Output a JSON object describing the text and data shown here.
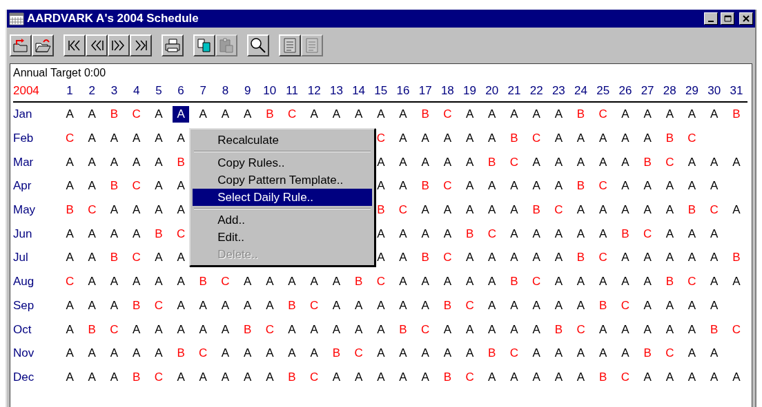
{
  "window": {
    "title": "AARDVARK A's 2004 Schedule"
  },
  "toolbar_groups": [
    [
      {
        "kind": "undo",
        "disabled": false
      },
      {
        "kind": "open",
        "disabled": false
      }
    ],
    [
      {
        "kind": "first",
        "disabled": false
      },
      {
        "kind": "prev",
        "disabled": false
      },
      {
        "kind": "next",
        "disabled": false
      },
      {
        "kind": "last",
        "disabled": false
      }
    ],
    [
      {
        "kind": "print",
        "disabled": false
      }
    ],
    [
      {
        "kind": "copy",
        "disabled": false
      },
      {
        "kind": "paste",
        "disabled": true
      }
    ],
    [
      {
        "kind": "find",
        "disabled": false
      }
    ],
    [
      {
        "kind": "page",
        "disabled": false
      },
      {
        "kind": "page",
        "disabled": true
      }
    ]
  ],
  "annual_target": "Annual Target 0:00",
  "year": "2004",
  "days": [
    "1",
    "2",
    "3",
    "4",
    "5",
    "6",
    "7",
    "8",
    "9",
    "10",
    "11",
    "12",
    "13",
    "14",
    "15",
    "16",
    "17",
    "18",
    "19",
    "20",
    "21",
    "22",
    "23",
    "24",
    "25",
    "26",
    "27",
    "28",
    "29",
    "30",
    "31"
  ],
  "months": [
    {
      "name": "Jan",
      "cells": [
        {
          "text": "A",
          "color": "#000000",
          "selected": false
        },
        {
          "text": "A",
          "color": "#000000",
          "selected": false
        },
        {
          "text": "B",
          "color": "#ff0000",
          "selected": false
        },
        {
          "text": "C",
          "color": "#ff0000",
          "selected": false
        },
        {
          "text": "A",
          "color": "#000000",
          "selected": false
        },
        {
          "text": "A",
          "selected": true
        },
        {
          "text": "A",
          "color": "#000000",
          "selected": false
        },
        {
          "text": "A",
          "color": "#000000",
          "selected": false
        },
        {
          "text": "A",
          "color": "#000000",
          "selected": false
        },
        {
          "text": "B",
          "color": "#ff0000",
          "selected": false
        },
        {
          "text": "C",
          "color": "#ff0000",
          "selected": false
        },
        {
          "text": "A",
          "color": "#000000",
          "selected": false
        },
        {
          "text": "A",
          "color": "#000000",
          "selected": false
        },
        {
          "text": "A",
          "color": "#000000",
          "selected": false
        },
        {
          "text": "A",
          "color": "#000000",
          "selected": false
        },
        {
          "text": "A",
          "color": "#000000",
          "selected": false
        },
        {
          "text": "B",
          "color": "#ff0000",
          "selected": false
        },
        {
          "text": "C",
          "color": "#ff0000",
          "selected": false
        },
        {
          "text": "A",
          "color": "#000000",
          "selected": false
        },
        {
          "text": "A",
          "color": "#000000",
          "selected": false
        },
        {
          "text": "A",
          "color": "#000000",
          "selected": false
        },
        {
          "text": "A",
          "color": "#000000",
          "selected": false
        },
        {
          "text": "A",
          "color": "#000000",
          "selected": false
        },
        {
          "text": "B",
          "color": "#ff0000",
          "selected": false
        },
        {
          "text": "C",
          "color": "#ff0000",
          "selected": false
        },
        {
          "text": "A",
          "color": "#000000",
          "selected": false
        },
        {
          "text": "A",
          "color": "#000000",
          "selected": false
        },
        {
          "text": "A",
          "color": "#000000",
          "selected": false
        },
        {
          "text": "A",
          "color": "#000000",
          "selected": false
        },
        {
          "text": "A",
          "color": "#000000",
          "selected": false
        },
        {
          "text": "B",
          "color": "#ff0000",
          "selected": false
        }
      ]
    },
    {
      "name": "Feb",
      "cells": [
        {
          "text": "C",
          "color": "#ff0000",
          "selected": false
        },
        {
          "text": "A",
          "color": "#000000",
          "selected": false
        },
        {
          "text": "A",
          "color": "#000000",
          "selected": false
        },
        {
          "text": "A",
          "color": "#000000",
          "selected": false
        },
        {
          "text": "A",
          "color": "#000000",
          "selected": false
        },
        {
          "text": "A",
          "color": "#000000",
          "selected": false
        },
        null,
        null,
        null,
        null,
        null,
        null,
        null,
        null,
        {
          "text": "C",
          "color": "#ff0000",
          "selected": false
        },
        {
          "text": "A",
          "color": "#000000",
          "selected": false
        },
        {
          "text": "A",
          "color": "#000000",
          "selected": false
        },
        {
          "text": "A",
          "color": "#000000",
          "selected": false
        },
        {
          "text": "A",
          "color": "#000000",
          "selected": false
        },
        {
          "text": "A",
          "color": "#000000",
          "selected": false
        },
        {
          "text": "B",
          "color": "#ff0000",
          "selected": false
        },
        {
          "text": "C",
          "color": "#ff0000",
          "selected": false
        },
        {
          "text": "A",
          "color": "#000000",
          "selected": false
        },
        {
          "text": "A",
          "color": "#000000",
          "selected": false
        },
        {
          "text": "A",
          "color": "#000000",
          "selected": false
        },
        {
          "text": "A",
          "color": "#000000",
          "selected": false
        },
        {
          "text": "A",
          "color": "#000000",
          "selected": false
        },
        {
          "text": "B",
          "color": "#ff0000",
          "selected": false
        },
        {
          "text": "C",
          "color": "#ff0000",
          "selected": false
        },
        null,
        null
      ]
    },
    {
      "name": "Mar",
      "cells": [
        {
          "text": "A",
          "color": "#000000",
          "selected": false
        },
        {
          "text": "A",
          "color": "#000000",
          "selected": false
        },
        {
          "text": "A",
          "color": "#000000",
          "selected": false
        },
        {
          "text": "A",
          "color": "#000000",
          "selected": false
        },
        {
          "text": "A",
          "color": "#000000",
          "selected": false
        },
        {
          "text": "B",
          "color": "#ff0000",
          "selected": false
        },
        null,
        null,
        null,
        null,
        null,
        null,
        null,
        null,
        {
          "text": "A",
          "color": "#000000",
          "selected": false
        },
        {
          "text": "A",
          "color": "#000000",
          "selected": false
        },
        {
          "text": "A",
          "color": "#000000",
          "selected": false
        },
        {
          "text": "A",
          "color": "#000000",
          "selected": false
        },
        {
          "text": "A",
          "color": "#000000",
          "selected": false
        },
        {
          "text": "B",
          "color": "#ff0000",
          "selected": false
        },
        {
          "text": "C",
          "color": "#ff0000",
          "selected": false
        },
        {
          "text": "A",
          "color": "#000000",
          "selected": false
        },
        {
          "text": "A",
          "color": "#000000",
          "selected": false
        },
        {
          "text": "A",
          "color": "#000000",
          "selected": false
        },
        {
          "text": "A",
          "color": "#000000",
          "selected": false
        },
        {
          "text": "A",
          "color": "#000000",
          "selected": false
        },
        {
          "text": "B",
          "color": "#ff0000",
          "selected": false
        },
        {
          "text": "C",
          "color": "#ff0000",
          "selected": false
        },
        {
          "text": "A",
          "color": "#000000",
          "selected": false
        },
        {
          "text": "A",
          "color": "#000000",
          "selected": false
        },
        {
          "text": "A",
          "color": "#000000",
          "selected": false
        }
      ]
    },
    {
      "name": "Apr",
      "cells": [
        {
          "text": "A",
          "color": "#000000",
          "selected": false
        },
        {
          "text": "A",
          "color": "#000000",
          "selected": false
        },
        {
          "text": "B",
          "color": "#ff0000",
          "selected": false
        },
        {
          "text": "C",
          "color": "#ff0000",
          "selected": false
        },
        {
          "text": "A",
          "color": "#000000",
          "selected": false
        },
        {
          "text": "A",
          "color": "#000000",
          "selected": false
        },
        null,
        null,
        null,
        null,
        null,
        null,
        null,
        null,
        {
          "text": "A",
          "color": "#000000",
          "selected": false
        },
        {
          "text": "A",
          "color": "#000000",
          "selected": false
        },
        {
          "text": "B",
          "color": "#ff0000",
          "selected": false
        },
        {
          "text": "C",
          "color": "#ff0000",
          "selected": false
        },
        {
          "text": "A",
          "color": "#000000",
          "selected": false
        },
        {
          "text": "A",
          "color": "#000000",
          "selected": false
        },
        {
          "text": "A",
          "color": "#000000",
          "selected": false
        },
        {
          "text": "A",
          "color": "#000000",
          "selected": false
        },
        {
          "text": "A",
          "color": "#000000",
          "selected": false
        },
        {
          "text": "B",
          "color": "#ff0000",
          "selected": false
        },
        {
          "text": "C",
          "color": "#ff0000",
          "selected": false
        },
        {
          "text": "A",
          "color": "#000000",
          "selected": false
        },
        {
          "text": "A",
          "color": "#000000",
          "selected": false
        },
        {
          "text": "A",
          "color": "#000000",
          "selected": false
        },
        {
          "text": "A",
          "color": "#000000",
          "selected": false
        },
        {
          "text": "A",
          "color": "#000000",
          "selected": false
        },
        null
      ]
    },
    {
      "name": "May",
      "cells": [
        {
          "text": "B",
          "color": "#ff0000",
          "selected": false
        },
        {
          "text": "C",
          "color": "#ff0000",
          "selected": false
        },
        {
          "text": "A",
          "color": "#000000",
          "selected": false
        },
        {
          "text": "A",
          "color": "#000000",
          "selected": false
        },
        {
          "text": "A",
          "color": "#000000",
          "selected": false
        },
        {
          "text": "A",
          "color": "#000000",
          "selected": false
        },
        null,
        null,
        null,
        null,
        null,
        null,
        null,
        null,
        {
          "text": "B",
          "color": "#ff0000",
          "selected": false
        },
        {
          "text": "C",
          "color": "#ff0000",
          "selected": false
        },
        {
          "text": "A",
          "color": "#000000",
          "selected": false
        },
        {
          "text": "A",
          "color": "#000000",
          "selected": false
        },
        {
          "text": "A",
          "color": "#000000",
          "selected": false
        },
        {
          "text": "A",
          "color": "#000000",
          "selected": false
        },
        {
          "text": "A",
          "color": "#000000",
          "selected": false
        },
        {
          "text": "B",
          "color": "#ff0000",
          "selected": false
        },
        {
          "text": "C",
          "color": "#ff0000",
          "selected": false
        },
        {
          "text": "A",
          "color": "#000000",
          "selected": false
        },
        {
          "text": "A",
          "color": "#000000",
          "selected": false
        },
        {
          "text": "A",
          "color": "#000000",
          "selected": false
        },
        {
          "text": "A",
          "color": "#000000",
          "selected": false
        },
        {
          "text": "A",
          "color": "#000000",
          "selected": false
        },
        {
          "text": "B",
          "color": "#ff0000",
          "selected": false
        },
        {
          "text": "C",
          "color": "#ff0000",
          "selected": false
        },
        {
          "text": "A",
          "color": "#000000",
          "selected": false
        }
      ]
    },
    {
      "name": "Jun",
      "cells": [
        {
          "text": "A",
          "color": "#000000",
          "selected": false
        },
        {
          "text": "A",
          "color": "#000000",
          "selected": false
        },
        {
          "text": "A",
          "color": "#000000",
          "selected": false
        },
        {
          "text": "A",
          "color": "#000000",
          "selected": false
        },
        {
          "text": "B",
          "color": "#ff0000",
          "selected": false
        },
        {
          "text": "C",
          "color": "#ff0000",
          "selected": false
        },
        null,
        null,
        null,
        null,
        null,
        null,
        null,
        null,
        {
          "text": "A",
          "color": "#000000",
          "selected": false
        },
        {
          "text": "A",
          "color": "#000000",
          "selected": false
        },
        {
          "text": "A",
          "color": "#000000",
          "selected": false
        },
        {
          "text": "A",
          "color": "#000000",
          "selected": false
        },
        {
          "text": "B",
          "color": "#ff0000",
          "selected": false
        },
        {
          "text": "C",
          "color": "#ff0000",
          "selected": false
        },
        {
          "text": "A",
          "color": "#000000",
          "selected": false
        },
        {
          "text": "A",
          "color": "#000000",
          "selected": false
        },
        {
          "text": "A",
          "color": "#000000",
          "selected": false
        },
        {
          "text": "A",
          "color": "#000000",
          "selected": false
        },
        {
          "text": "A",
          "color": "#000000",
          "selected": false
        },
        {
          "text": "B",
          "color": "#ff0000",
          "selected": false
        },
        {
          "text": "C",
          "color": "#ff0000",
          "selected": false
        },
        {
          "text": "A",
          "color": "#000000",
          "selected": false
        },
        {
          "text": "A",
          "color": "#000000",
          "selected": false
        },
        {
          "text": "A",
          "color": "#000000",
          "selected": false
        },
        null
      ]
    },
    {
      "name": "Jul",
      "cells": [
        {
          "text": "A",
          "color": "#000000",
          "selected": false
        },
        {
          "text": "A",
          "color": "#000000",
          "selected": false
        },
        {
          "text": "B",
          "color": "#ff0000",
          "selected": false
        },
        {
          "text": "C",
          "color": "#ff0000",
          "selected": false
        },
        {
          "text": "A",
          "color": "#000000",
          "selected": false
        },
        {
          "text": "A",
          "color": "#000000",
          "selected": false
        },
        null,
        null,
        null,
        null,
        null,
        null,
        null,
        null,
        {
          "text": "A",
          "color": "#000000",
          "selected": false
        },
        {
          "text": "A",
          "color": "#000000",
          "selected": false
        },
        {
          "text": "B",
          "color": "#ff0000",
          "selected": false
        },
        {
          "text": "C",
          "color": "#ff0000",
          "selected": false
        },
        {
          "text": "A",
          "color": "#000000",
          "selected": false
        },
        {
          "text": "A",
          "color": "#000000",
          "selected": false
        },
        {
          "text": "A",
          "color": "#000000",
          "selected": false
        },
        {
          "text": "A",
          "color": "#000000",
          "selected": false
        },
        {
          "text": "A",
          "color": "#000000",
          "selected": false
        },
        {
          "text": "B",
          "color": "#ff0000",
          "selected": false
        },
        {
          "text": "C",
          "color": "#ff0000",
          "selected": false
        },
        {
          "text": "A",
          "color": "#000000",
          "selected": false
        },
        {
          "text": "A",
          "color": "#000000",
          "selected": false
        },
        {
          "text": "A",
          "color": "#000000",
          "selected": false
        },
        {
          "text": "A",
          "color": "#000000",
          "selected": false
        },
        {
          "text": "A",
          "color": "#000000",
          "selected": false
        },
        {
          "text": "B",
          "color": "#ff0000",
          "selected": false
        }
      ]
    },
    {
      "name": "Aug",
      "cells": [
        {
          "text": "C",
          "color": "#ff0000",
          "selected": false
        },
        {
          "text": "A",
          "color": "#000000",
          "selected": false
        },
        {
          "text": "A",
          "color": "#000000",
          "selected": false
        },
        {
          "text": "A",
          "color": "#000000",
          "selected": false
        },
        {
          "text": "A",
          "color": "#000000",
          "selected": false
        },
        {
          "text": "A",
          "color": "#000000",
          "selected": false
        },
        {
          "text": "B",
          "color": "#ff0000",
          "selected": false
        },
        {
          "text": "C",
          "color": "#ff0000",
          "selected": false
        },
        {
          "text": "A",
          "color": "#000000",
          "selected": false
        },
        {
          "text": "A",
          "color": "#000000",
          "selected": false
        },
        {
          "text": "A",
          "color": "#000000",
          "selected": false
        },
        {
          "text": "A",
          "color": "#000000",
          "selected": false
        },
        {
          "text": "A",
          "color": "#000000",
          "selected": false
        },
        {
          "text": "B",
          "color": "#ff0000",
          "selected": false
        },
        {
          "text": "C",
          "color": "#ff0000",
          "selected": false
        },
        {
          "text": "A",
          "color": "#000000",
          "selected": false
        },
        {
          "text": "A",
          "color": "#000000",
          "selected": false
        },
        {
          "text": "A",
          "color": "#000000",
          "selected": false
        },
        {
          "text": "A",
          "color": "#000000",
          "selected": false
        },
        {
          "text": "A",
          "color": "#000000",
          "selected": false
        },
        {
          "text": "B",
          "color": "#ff0000",
          "selected": false
        },
        {
          "text": "C",
          "color": "#ff0000",
          "selected": false
        },
        {
          "text": "A",
          "color": "#000000",
          "selected": false
        },
        {
          "text": "A",
          "color": "#000000",
          "selected": false
        },
        {
          "text": "A",
          "color": "#000000",
          "selected": false
        },
        {
          "text": "A",
          "color": "#000000",
          "selected": false
        },
        {
          "text": "A",
          "color": "#000000",
          "selected": false
        },
        {
          "text": "B",
          "color": "#ff0000",
          "selected": false
        },
        {
          "text": "C",
          "color": "#ff0000",
          "selected": false
        },
        {
          "text": "A",
          "color": "#000000",
          "selected": false
        },
        {
          "text": "A",
          "color": "#000000",
          "selected": false
        }
      ]
    },
    {
      "name": "Sep",
      "cells": [
        {
          "text": "A",
          "color": "#000000",
          "selected": false
        },
        {
          "text": "A",
          "color": "#000000",
          "selected": false
        },
        {
          "text": "A",
          "color": "#000000",
          "selected": false
        },
        {
          "text": "B",
          "color": "#ff0000",
          "selected": false
        },
        {
          "text": "C",
          "color": "#ff0000",
          "selected": false
        },
        {
          "text": "A",
          "color": "#000000",
          "selected": false
        },
        {
          "text": "A",
          "color": "#000000",
          "selected": false
        },
        {
          "text": "A",
          "color": "#000000",
          "selected": false
        },
        {
          "text": "A",
          "color": "#000000",
          "selected": false
        },
        {
          "text": "A",
          "color": "#000000",
          "selected": false
        },
        {
          "text": "B",
          "color": "#ff0000",
          "selected": false
        },
        {
          "text": "C",
          "color": "#ff0000",
          "selected": false
        },
        {
          "text": "A",
          "color": "#000000",
          "selected": false
        },
        {
          "text": "A",
          "color": "#000000",
          "selected": false
        },
        {
          "text": "A",
          "color": "#000000",
          "selected": false
        },
        {
          "text": "A",
          "color": "#000000",
          "selected": false
        },
        {
          "text": "A",
          "color": "#000000",
          "selected": false
        },
        {
          "text": "B",
          "color": "#ff0000",
          "selected": false
        },
        {
          "text": "C",
          "color": "#ff0000",
          "selected": false
        },
        {
          "text": "A",
          "color": "#000000",
          "selected": false
        },
        {
          "text": "A",
          "color": "#000000",
          "selected": false
        },
        {
          "text": "A",
          "color": "#000000",
          "selected": false
        },
        {
          "text": "A",
          "color": "#000000",
          "selected": false
        },
        {
          "text": "A",
          "color": "#000000",
          "selected": false
        },
        {
          "text": "B",
          "color": "#ff0000",
          "selected": false
        },
        {
          "text": "C",
          "color": "#ff0000",
          "selected": false
        },
        {
          "text": "A",
          "color": "#000000",
          "selected": false
        },
        {
          "text": "A",
          "color": "#000000",
          "selected": false
        },
        {
          "text": "A",
          "color": "#000000",
          "selected": false
        },
        {
          "text": "A",
          "color": "#000000",
          "selected": false
        },
        null
      ]
    },
    {
      "name": "Oct",
      "cells": [
        {
          "text": "A",
          "color": "#000000",
          "selected": false
        },
        {
          "text": "B",
          "color": "#ff0000",
          "selected": false
        },
        {
          "text": "C",
          "color": "#ff0000",
          "selected": false
        },
        {
          "text": "A",
          "color": "#000000",
          "selected": false
        },
        {
          "text": "A",
          "color": "#000000",
          "selected": false
        },
        {
          "text": "A",
          "color": "#000000",
          "selected": false
        },
        {
          "text": "A",
          "color": "#000000",
          "selected": false
        },
        {
          "text": "A",
          "color": "#000000",
          "selected": false
        },
        {
          "text": "B",
          "color": "#ff0000",
          "selected": false
        },
        {
          "text": "C",
          "color": "#ff0000",
          "selected": false
        },
        {
          "text": "A",
          "color": "#000000",
          "selected": false
        },
        {
          "text": "A",
          "color": "#000000",
          "selected": false
        },
        {
          "text": "A",
          "color": "#000000",
          "selected": false
        },
        {
          "text": "A",
          "color": "#000000",
          "selected": false
        },
        {
          "text": "A",
          "color": "#000000",
          "selected": false
        },
        {
          "text": "B",
          "color": "#ff0000",
          "selected": false
        },
        {
          "text": "C",
          "color": "#ff0000",
          "selected": false
        },
        {
          "text": "A",
          "color": "#000000",
          "selected": false
        },
        {
          "text": "A",
          "color": "#000000",
          "selected": false
        },
        {
          "text": "A",
          "color": "#000000",
          "selected": false
        },
        {
          "text": "A",
          "color": "#000000",
          "selected": false
        },
        {
          "text": "A",
          "color": "#000000",
          "selected": false
        },
        {
          "text": "B",
          "color": "#ff0000",
          "selected": false
        },
        {
          "text": "C",
          "color": "#ff0000",
          "selected": false
        },
        {
          "text": "A",
          "color": "#000000",
          "selected": false
        },
        {
          "text": "A",
          "color": "#000000",
          "selected": false
        },
        {
          "text": "A",
          "color": "#000000",
          "selected": false
        },
        {
          "text": "A",
          "color": "#000000",
          "selected": false
        },
        {
          "text": "A",
          "color": "#000000",
          "selected": false
        },
        {
          "text": "B",
          "color": "#ff0000",
          "selected": false
        },
        {
          "text": "C",
          "color": "#ff0000",
          "selected": false
        }
      ]
    },
    {
      "name": "Nov",
      "cells": [
        {
          "text": "A",
          "color": "#000000",
          "selected": false
        },
        {
          "text": "A",
          "color": "#000000",
          "selected": false
        },
        {
          "text": "A",
          "color": "#000000",
          "selected": false
        },
        {
          "text": "A",
          "color": "#000000",
          "selected": false
        },
        {
          "text": "A",
          "color": "#000000",
          "selected": false
        },
        {
          "text": "B",
          "color": "#ff0000",
          "selected": false
        },
        {
          "text": "C",
          "color": "#ff0000",
          "selected": false
        },
        {
          "text": "A",
          "color": "#000000",
          "selected": false
        },
        {
          "text": "A",
          "color": "#000000",
          "selected": false
        },
        {
          "text": "A",
          "color": "#000000",
          "selected": false
        },
        {
          "text": "A",
          "color": "#000000",
          "selected": false
        },
        {
          "text": "A",
          "color": "#000000",
          "selected": false
        },
        {
          "text": "B",
          "color": "#ff0000",
          "selected": false
        },
        {
          "text": "C",
          "color": "#ff0000",
          "selected": false
        },
        {
          "text": "A",
          "color": "#000000",
          "selected": false
        },
        {
          "text": "A",
          "color": "#000000",
          "selected": false
        },
        {
          "text": "A",
          "color": "#000000",
          "selected": false
        },
        {
          "text": "A",
          "color": "#000000",
          "selected": false
        },
        {
          "text": "A",
          "color": "#000000",
          "selected": false
        },
        {
          "text": "B",
          "color": "#ff0000",
          "selected": false
        },
        {
          "text": "C",
          "color": "#ff0000",
          "selected": false
        },
        {
          "text": "A",
          "color": "#000000",
          "selected": false
        },
        {
          "text": "A",
          "color": "#000000",
          "selected": false
        },
        {
          "text": "A",
          "color": "#000000",
          "selected": false
        },
        {
          "text": "A",
          "color": "#000000",
          "selected": false
        },
        {
          "text": "A",
          "color": "#000000",
          "selected": false
        },
        {
          "text": "B",
          "color": "#ff0000",
          "selected": false
        },
        {
          "text": "C",
          "color": "#ff0000",
          "selected": false
        },
        {
          "text": "A",
          "color": "#000000",
          "selected": false
        },
        {
          "text": "A",
          "color": "#000000",
          "selected": false
        },
        null
      ]
    },
    {
      "name": "Dec",
      "cells": [
        {
          "text": "A",
          "color": "#000000",
          "selected": false
        },
        {
          "text": "A",
          "color": "#000000",
          "selected": false
        },
        {
          "text": "A",
          "color": "#000000",
          "selected": false
        },
        {
          "text": "B",
          "color": "#ff0000",
          "selected": false
        },
        {
          "text": "C",
          "color": "#ff0000",
          "selected": false
        },
        {
          "text": "A",
          "color": "#000000",
          "selected": false
        },
        {
          "text": "A",
          "color": "#000000",
          "selected": false
        },
        {
          "text": "A",
          "color": "#000000",
          "selected": false
        },
        {
          "text": "A",
          "color": "#000000",
          "selected": false
        },
        {
          "text": "A",
          "color": "#000000",
          "selected": false
        },
        {
          "text": "B",
          "color": "#ff0000",
          "selected": false
        },
        {
          "text": "C",
          "color": "#ff0000",
          "selected": false
        },
        {
          "text": "A",
          "color": "#000000",
          "selected": false
        },
        {
          "text": "A",
          "color": "#000000",
          "selected": false
        },
        {
          "text": "A",
          "color": "#000000",
          "selected": false
        },
        {
          "text": "A",
          "color": "#000000",
          "selected": false
        },
        {
          "text": "A",
          "color": "#000000",
          "selected": false
        },
        {
          "text": "B",
          "color": "#ff0000",
          "selected": false
        },
        {
          "text": "C",
          "color": "#ff0000",
          "selected": false
        },
        {
          "text": "A",
          "color": "#000000",
          "selected": false
        },
        {
          "text": "A",
          "color": "#000000",
          "selected": false
        },
        {
          "text": "A",
          "color": "#000000",
          "selected": false
        },
        {
          "text": "A",
          "color": "#000000",
          "selected": false
        },
        {
          "text": "A",
          "color": "#000000",
          "selected": false
        },
        {
          "text": "B",
          "color": "#ff0000",
          "selected": false
        },
        {
          "text": "C",
          "color": "#ff0000",
          "selected": false
        },
        {
          "text": "A",
          "color": "#000000",
          "selected": false
        },
        {
          "text": "A",
          "color": "#000000",
          "selected": false
        },
        {
          "text": "A",
          "color": "#000000",
          "selected": false
        },
        {
          "text": "A",
          "color": "#000000",
          "selected": false
        },
        {
          "text": "A",
          "color": "#000000",
          "selected": false
        }
      ]
    }
  ],
  "context_menu": [
    {
      "kind": "item",
      "label": "Recalculate",
      "selected": false,
      "disabled": false
    },
    {
      "kind": "separator"
    },
    {
      "kind": "item",
      "label": "Copy Rules..",
      "selected": false,
      "disabled": false
    },
    {
      "kind": "item",
      "label": "Copy Pattern Template..",
      "selected": false,
      "disabled": false
    },
    {
      "kind": "item",
      "label": "Select Daily Rule..",
      "selected": true,
      "disabled": false
    },
    {
      "kind": "separator"
    },
    {
      "kind": "item",
      "label": "Add..",
      "selected": false,
      "disabled": false
    },
    {
      "kind": "item",
      "label": "Edit..",
      "selected": false,
      "disabled": false
    },
    {
      "kind": "item",
      "label": "Delete..",
      "selected": false,
      "disabled": true
    }
  ]
}
